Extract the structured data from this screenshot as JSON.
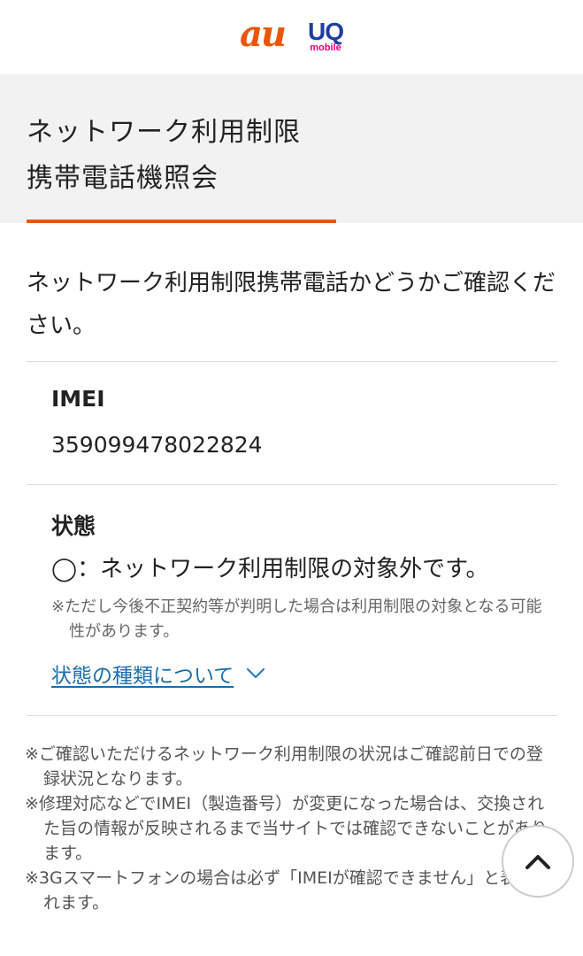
{
  "colors": {
    "au_brand": "#eb5505",
    "uq_brand": "#1e3ea0",
    "uq_sub": "#e6007e",
    "accent_orange": "#eb5505",
    "link_blue": "#1a6fae",
    "chevron_blue": "#2a7fc0"
  },
  "header": {
    "au_logo_text": "au",
    "uq_logo_text": "UQ",
    "uq_logo_sub": "mobile"
  },
  "title": {
    "line1": "ネットワーク利用制限",
    "line2": "携帯電話機照会"
  },
  "intro_text": "ネットワーク利用制限携帯電話かどうかご確認ください。",
  "imei": {
    "label": "IMEI",
    "value": "359099478022824"
  },
  "status": {
    "label": "状態",
    "result": "◯：ネットワーク利用制限の対象外です。",
    "note": "※ただし今後不正契約等が判明した場合は利用制限の対象となる可能性があります。",
    "link_text": "状態の種類について",
    "link_icon": "chevron-down-icon"
  },
  "notes": [
    "※ご確認いただけるネットワーク利用制限の状況はご確認前日での登録状況となります。",
    "※修理対応などでIMEI（製造番号）が変更になった場合は、交換された旨の情報が反映されるまで当サイトでは確認できないことがあります。",
    "※3Gスマートフォンの場合は必ず「IMEIが確認できません」と表記されます。"
  ],
  "scroll_top_icon": "chevron-up-icon"
}
